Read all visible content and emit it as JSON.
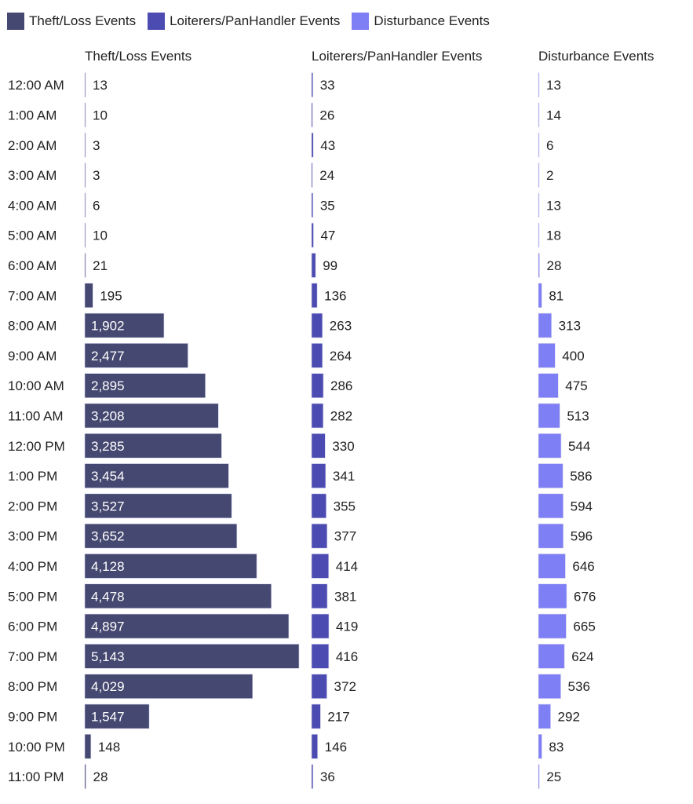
{
  "legend": [
    {
      "label": "Theft/Loss Events",
      "color": "#454870"
    },
    {
      "label": "Loiterers/PanHandler Events",
      "color": "#4b4bb2"
    },
    {
      "label": "Disturbance Events",
      "color": "#7f7ff5"
    }
  ],
  "chart_data": {
    "type": "bar",
    "orientation": "horizontal",
    "layout": "small-multiples (one column per series, independent scales)",
    "title": "",
    "categories": [
      "12:00 AM",
      "1:00 AM",
      "2:00 AM",
      "3:00 AM",
      "4:00 AM",
      "5:00 AM",
      "6:00 AM",
      "7:00 AM",
      "8:00 AM",
      "9:00 AM",
      "10:00 AM",
      "11:00 AM",
      "12:00 PM",
      "1:00 PM",
      "2:00 PM",
      "3:00 PM",
      "4:00 PM",
      "5:00 PM",
      "6:00 PM",
      "7:00 PM",
      "8:00 PM",
      "9:00 PM",
      "10:00 PM",
      "11:00 PM"
    ],
    "series": [
      {
        "name": "Theft/Loss Events",
        "color": "#454870",
        "values": [
          13,
          10,
          3,
          3,
          6,
          10,
          21,
          195,
          1902,
          2477,
          2895,
          3208,
          3285,
          3454,
          3527,
          3652,
          4128,
          4478,
          4897,
          5143,
          4029,
          1547,
          148,
          28
        ]
      },
      {
        "name": "Loiterers/PanHandler Events",
        "color": "#4b4bb2",
        "values": [
          33,
          26,
          43,
          24,
          35,
          47,
          99,
          136,
          263,
          264,
          286,
          282,
          330,
          341,
          355,
          377,
          414,
          381,
          419,
          416,
          372,
          217,
          146,
          36
        ]
      },
      {
        "name": "Disturbance Events",
        "color": "#7f7ff5",
        "values": [
          13,
          14,
          6,
          2,
          13,
          18,
          28,
          81,
          313,
          400,
          475,
          513,
          544,
          586,
          594,
          596,
          646,
          676,
          665,
          624,
          536,
          292,
          83,
          25
        ]
      }
    ],
    "legend_position": "top-left",
    "grid": false,
    "data_labels": true
  }
}
